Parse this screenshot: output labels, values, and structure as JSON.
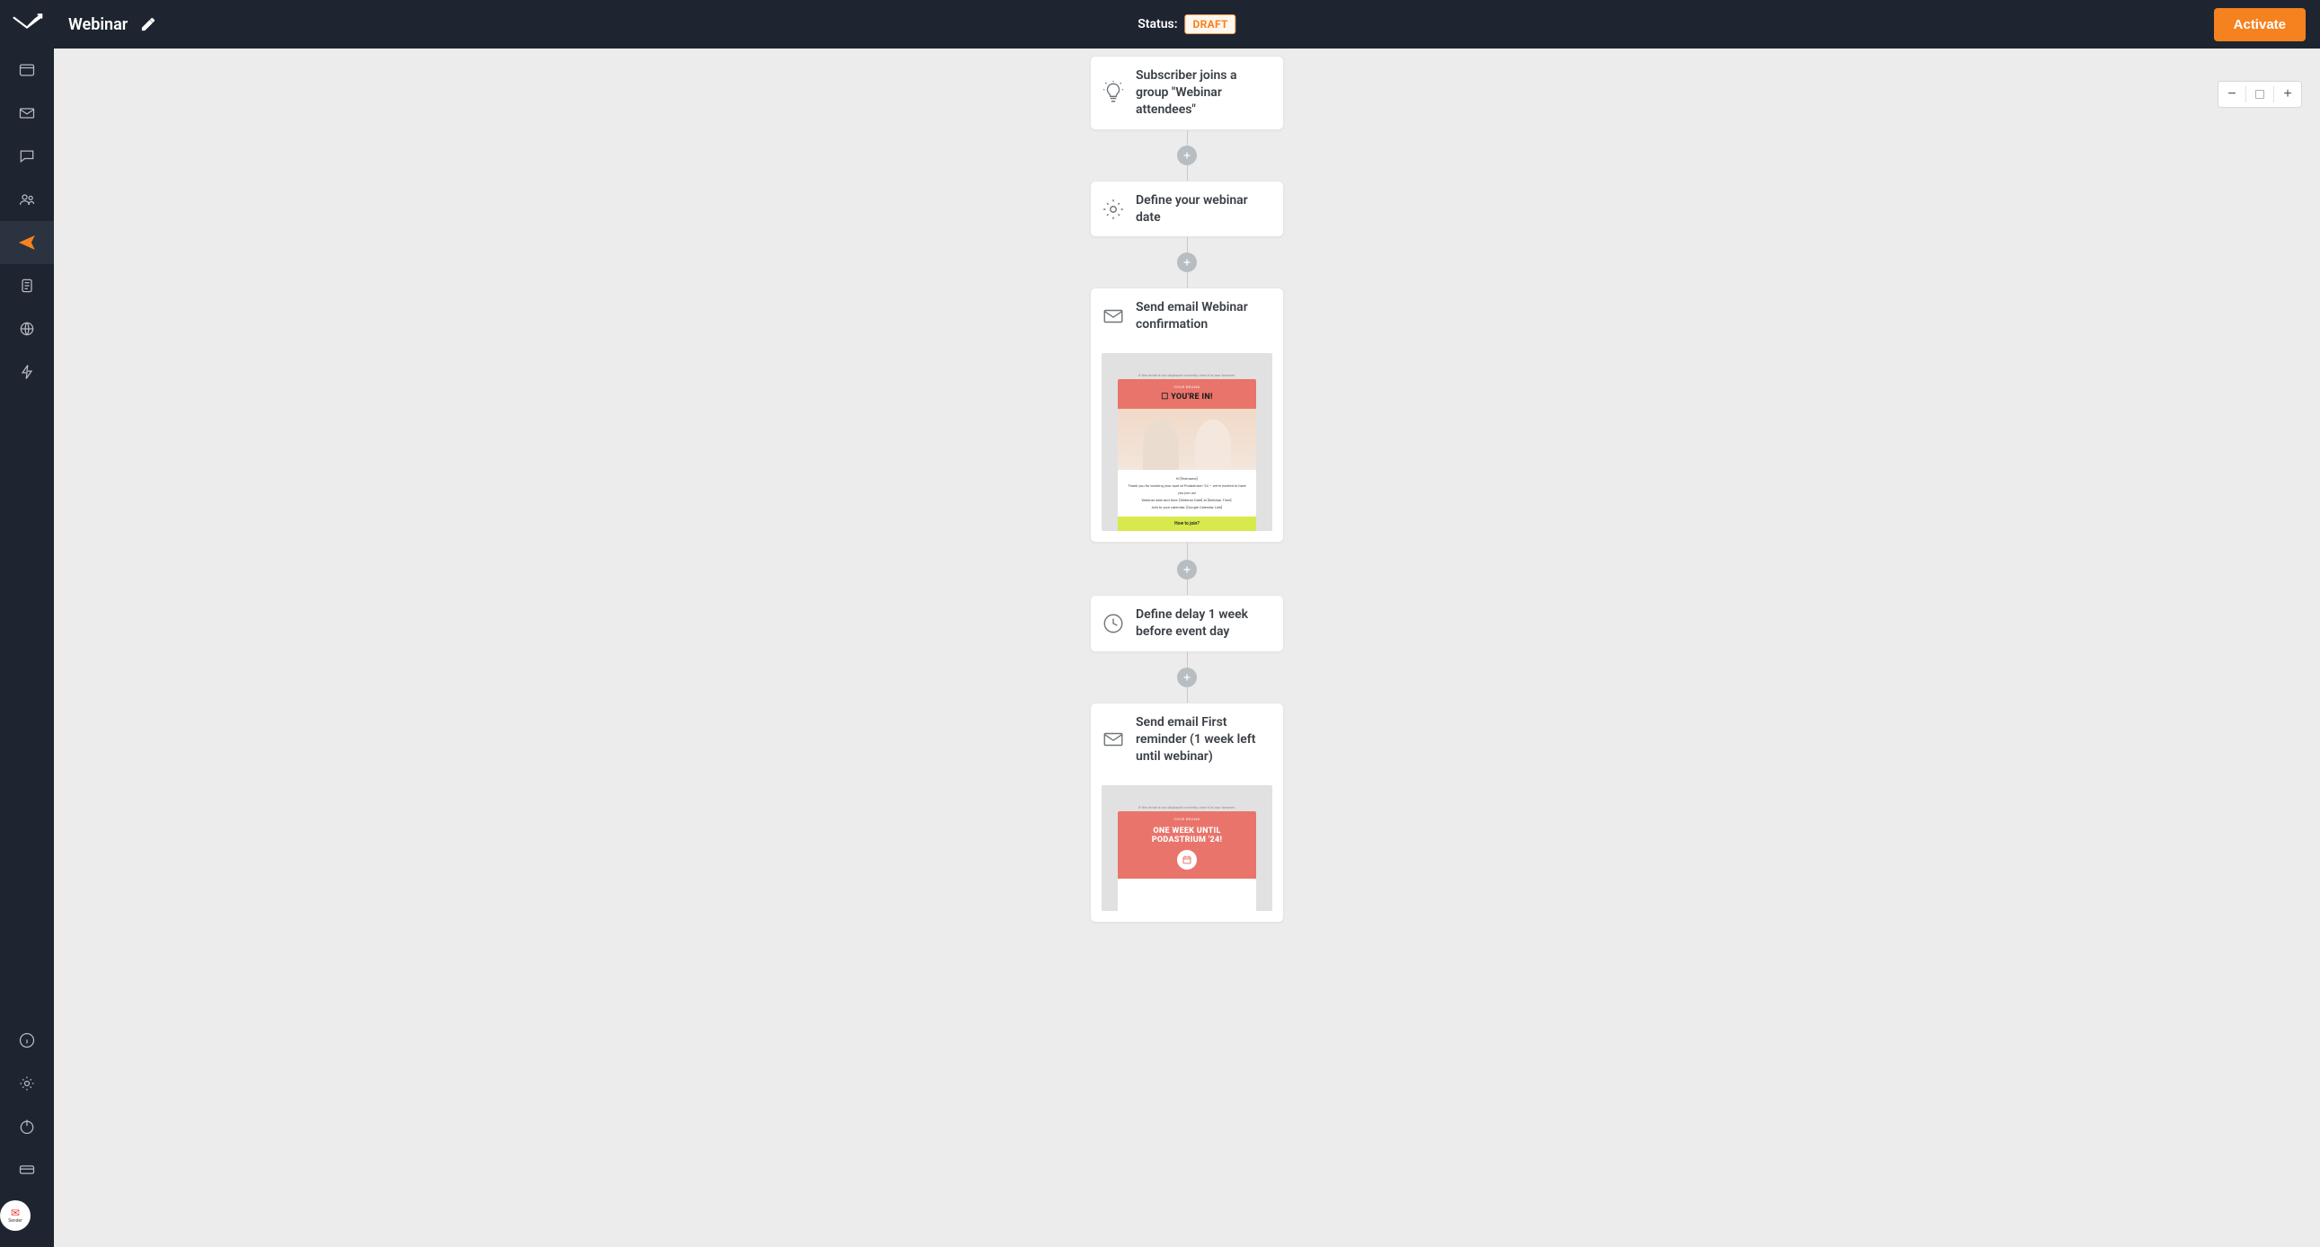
{
  "sidebar": {
    "items": [
      {
        "name": "dashboard-icon"
      },
      {
        "name": "mail-icon"
      },
      {
        "name": "chat-icon"
      },
      {
        "name": "contacts-icon"
      },
      {
        "name": "send-icon",
        "active": true
      },
      {
        "name": "clipboard-icon"
      },
      {
        "name": "globe-icon"
      },
      {
        "name": "bolt-icon"
      }
    ],
    "bottom": [
      {
        "name": "info-icon"
      },
      {
        "name": "settings-icon"
      },
      {
        "name": "power-icon"
      },
      {
        "name": "card-icon"
      }
    ],
    "app_badge": "Sender"
  },
  "header": {
    "title": "Webinar",
    "status_label": "Status:",
    "status_value": "DRAFT",
    "activate_label": "Activate"
  },
  "zoom": {
    "out": "−",
    "in": "+"
  },
  "flow": [
    {
      "id": "trigger",
      "icon": "lightbulb",
      "text": "Subscriber joins a group \"Webinar attendees\""
    },
    {
      "id": "define-date",
      "icon": "gear",
      "text": "Define your webinar date"
    },
    {
      "id": "email-confirm",
      "icon": "envelope",
      "text": "Send email Webinar confirmation",
      "preview": "confirm"
    },
    {
      "id": "delay-week",
      "icon": "clock",
      "text": "Define delay 1 week before event day"
    },
    {
      "id": "email-reminder",
      "icon": "envelope",
      "text": "Send email First reminder (1 week left until webinar)",
      "preview": "reminder"
    }
  ],
  "previews": {
    "confirm": {
      "brand": "YOUR BRAND",
      "headline": "☐ YOU'RE IN!",
      "greeting": "Hi [firstname],",
      "line1": "Thank you for booking your spot at Podastrium '24 — we're excited to have you join us!",
      "line2": "Webinar date and time: [Webinar Date] at [Webinar Time].",
      "line3": "Add to your calendar: [Google Calendar Link]",
      "cta": "How to join?"
    },
    "reminder": {
      "brand": "YOUR BRAND",
      "headline1": "ONE WEEK UNTIL",
      "headline2": "PODASTRIUM '24!"
    }
  }
}
